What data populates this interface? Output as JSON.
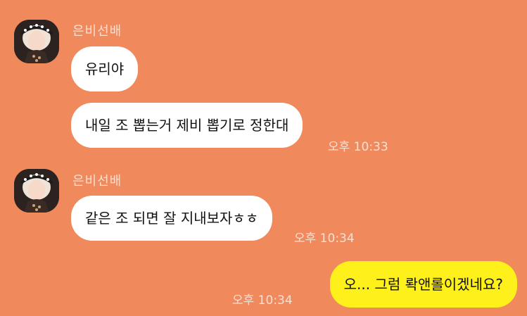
{
  "chat": {
    "groups": [
      {
        "sender": "은비선배",
        "avatar_icon": "profile-photo",
        "messages": [
          {
            "text": "유리야",
            "time": ""
          },
          {
            "text": "내일 조 뽑는거 제비 뽑기로 정한대",
            "time": "오후 10:33"
          }
        ]
      },
      {
        "sender": "은비선배",
        "avatar_icon": "profile-photo",
        "messages": [
          {
            "text": "같은 조 되면 잘 지내보자ㅎㅎ",
            "time": "오후 10:34"
          }
        ]
      }
    ],
    "outgoing": [
      {
        "text": "오... 그럼 롹앤롤이겠네요?",
        "time": "오후 10:34"
      }
    ]
  },
  "colors": {
    "background": "#f08a5d",
    "incoming_bubble": "#ffffff",
    "outgoing_bubble": "#fef01b",
    "meta_text": "#fbe0d2"
  }
}
